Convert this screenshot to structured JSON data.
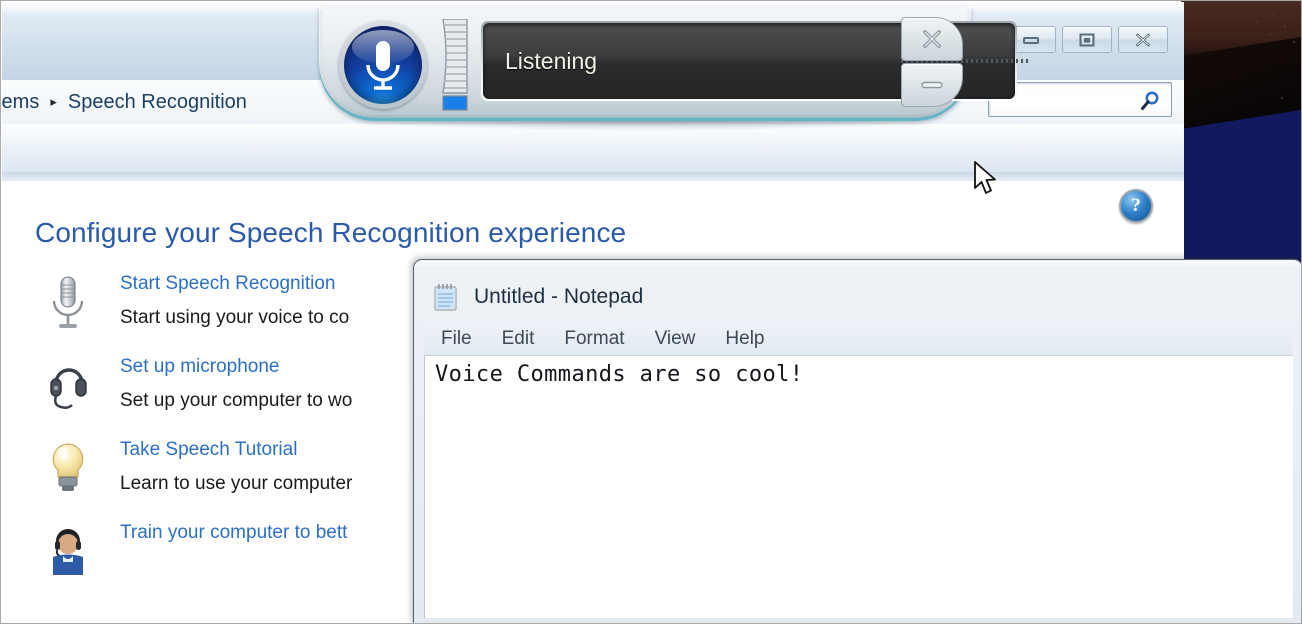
{
  "wallpaper": {
    "name": "desktop-wallpaper"
  },
  "control_panel": {
    "breadcrumb": {
      "truncated_parent": "tems",
      "separator": "▸",
      "current": "Speech Recognition"
    },
    "search": {
      "placeholder": "",
      "value": "",
      "icon": "search-icon"
    },
    "window_buttons": [
      {
        "name": "minimize",
        "glyph": "minimize-icon"
      },
      {
        "name": "maximize",
        "glyph": "maximize-icon"
      },
      {
        "name": "close",
        "glyph": "close-icon"
      }
    ],
    "help_button": {
      "label": "?",
      "icon": "help-icon"
    },
    "page_title": "Configure your Speech Recognition experience",
    "tasks": [
      {
        "icon": "microphone-icon",
        "link": "Start Speech Recognition",
        "description": "Start using your voice to co"
      },
      {
        "icon": "headset-icon",
        "link": "Set up microphone",
        "description": "Set up your computer to wo"
      },
      {
        "icon": "lightbulb-icon",
        "link": "Take Speech Tutorial",
        "description": "Learn to use your computer"
      },
      {
        "icon": "person-headset-icon",
        "link": "Train your computer to bett",
        "description": ""
      }
    ]
  },
  "speech_bar": {
    "mic_button": {
      "icon": "microphone-orb-icon",
      "state": "on"
    },
    "level_meter": {
      "icon": "level-meter-icon"
    },
    "status_text": "Listening",
    "close_button": {
      "glyph": "x-icon"
    },
    "minimize_button": {
      "glyph": "minus-icon"
    }
  },
  "notepad": {
    "icon": "notepad-icon",
    "title": "Untitled - Notepad",
    "menu": [
      "File",
      "Edit",
      "Format",
      "View",
      "Help"
    ],
    "document_text": "Voice Commands are so cool!"
  },
  "cursor": {
    "name": "mouse-pointer"
  },
  "colors": {
    "link_blue": "#2b6fc4",
    "title_blue": "#2b5ba8",
    "speech_accent_teal": "#62b4c6",
    "mic_orb_blue": "#0c6fd6",
    "display_bg": "#2a2b2d"
  }
}
